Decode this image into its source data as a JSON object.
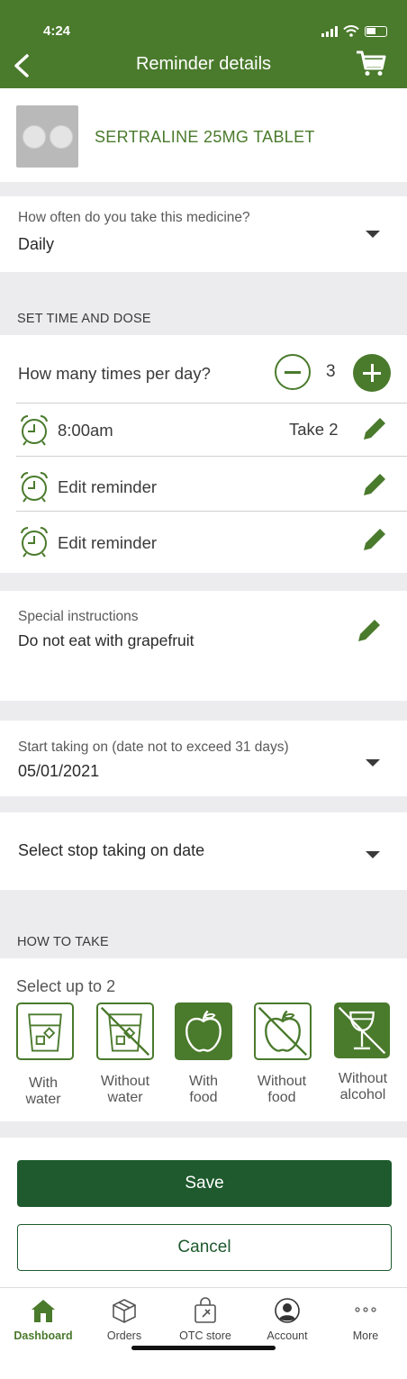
{
  "status_bar": {
    "time": "4:24"
  },
  "header": {
    "title": "Reminder details"
  },
  "product": {
    "name": "SERTRALINE 25MG TABLET"
  },
  "frequency": {
    "label": "How often do you take this medicine?",
    "value": "Daily"
  },
  "time_dose": {
    "section_title": "SET TIME AND DOSE",
    "times_label": "How many times per day?",
    "times_count": "3",
    "reminders": [
      {
        "time": "8:00am",
        "dose": "Take 2"
      },
      {
        "time": "Edit reminder",
        "dose": ""
      },
      {
        "time": "Edit reminder",
        "dose": ""
      }
    ]
  },
  "special_instructions": {
    "label": "Special instructions",
    "value": "Do not eat with grapefruit"
  },
  "start_date": {
    "label": "Start taking on (date not to exceed 31 days)",
    "value": "05/01/2021"
  },
  "stop_date": {
    "label": "Select stop taking on date"
  },
  "how_to_take": {
    "section_title": "HOW TO TAKE",
    "hint": "Select up to 2",
    "options": [
      {
        "line1": "With",
        "line2": "water",
        "icon": "glass-water-icon",
        "selected": false
      },
      {
        "line1": "Without",
        "line2": "water",
        "icon": "no-water-icon",
        "selected": false
      },
      {
        "line1": "With",
        "line2": "food",
        "icon": "apple-icon",
        "selected": true
      },
      {
        "line1": "Without",
        "line2": "food",
        "icon": "no-food-icon",
        "selected": false
      },
      {
        "line1": "Without",
        "line2": "alcohol",
        "icon": "no-alcohol-icon",
        "selected": true
      }
    ]
  },
  "actions": {
    "save": "Save",
    "cancel": "Cancel"
  },
  "tabbar": {
    "items": [
      {
        "label": "Dashboard",
        "icon": "home-icon",
        "active": true
      },
      {
        "label": "Orders",
        "icon": "box-icon",
        "active": false
      },
      {
        "label": "OTC store",
        "icon": "shopping-bag-icon",
        "active": false
      },
      {
        "label": "Account",
        "icon": "person-icon",
        "active": false
      },
      {
        "label": "More",
        "icon": "more-dots-icon",
        "active": false
      }
    ]
  },
  "colors": {
    "brand": "#4a7a2c",
    "button": "#1e5a2e",
    "background_gray": "#ececee"
  }
}
